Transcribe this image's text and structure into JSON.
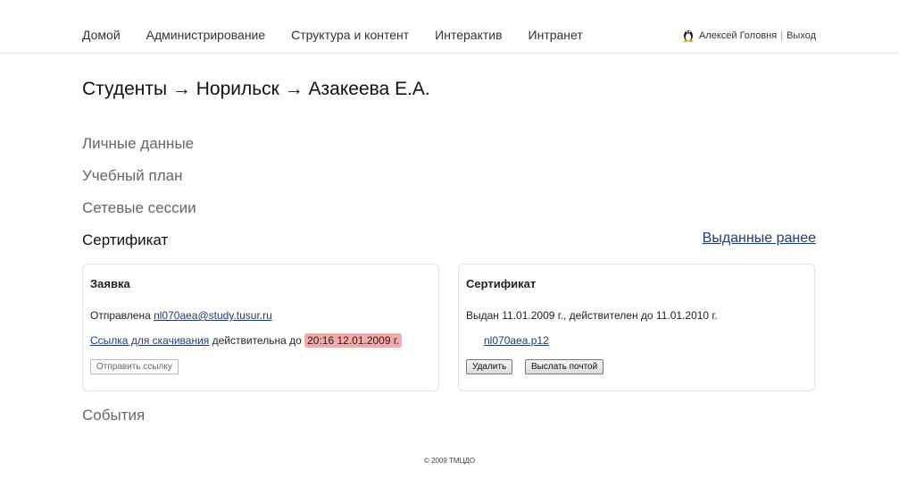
{
  "nav": {
    "items": [
      {
        "label": "Домой"
      },
      {
        "label": "Администрирование"
      },
      {
        "label": "Структура и контент"
      },
      {
        "label": "Интерактив"
      },
      {
        "label": "Интранет"
      }
    ]
  },
  "user": {
    "name": "Алексей Головня",
    "separator": "|",
    "logout": "Выход",
    "icon": "linux-tux-icon"
  },
  "page": {
    "breadcrumb": "Студенты → Норильск → Азакеева Е.А."
  },
  "sections": {
    "personal": "Личные данные",
    "plan": "Учебный план",
    "sessions": "Сетевые сессии",
    "certificate": "Сертификат",
    "events": "События",
    "issued_earlier": "Выданные ранее"
  },
  "request_panel": {
    "title": "Заявка",
    "sent_prefix": "Отправлена ",
    "email": "nl070aea@study.tusur.ru",
    "download_link": "Ссылка для скачивания",
    "valid_until_text": " действительна до ",
    "valid_until": "20:16 12.01.2009 г.",
    "send_link_button": "Отправить ссылку",
    "highlight_color": "#f7a8a8"
  },
  "cert_panel": {
    "title": "Сертификат",
    "issued_text": "Выдан 11.01.2009 г., действителен до 11.01.2010 г.",
    "file": "nl070aea.p12",
    "delete_button": "Удалить",
    "mail_button": "Выслать почтой"
  },
  "footer": {
    "copyright": "© 2009 ТМЦДО"
  }
}
